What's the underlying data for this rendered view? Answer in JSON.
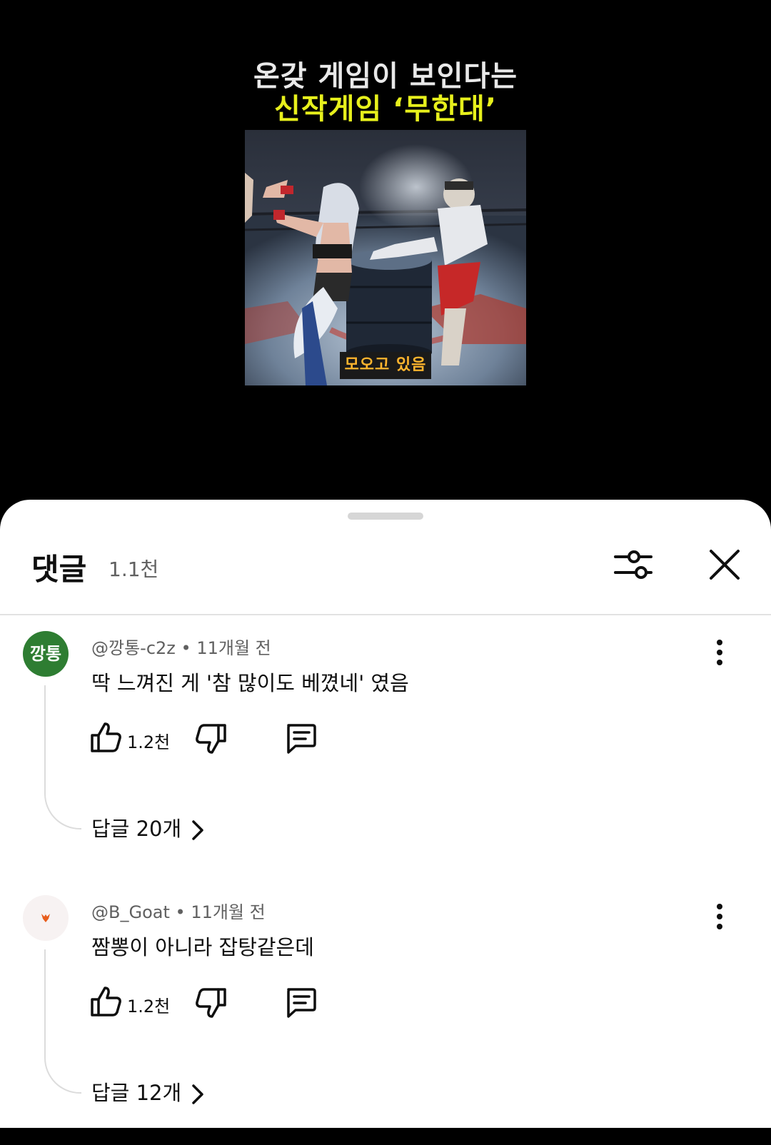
{
  "video": {
    "caption_line1": "온갖 게임이 보인다는",
    "caption_line2": "신작게임 ‘무한대’",
    "subtitle": "모오고 있음",
    "colors": {
      "caption1": "#e9e9e9",
      "caption2": "#e7f01c",
      "subtitle": "#ffb52e"
    }
  },
  "sheet": {
    "title": "댓글",
    "count": "1.1천",
    "filter_icon": "sliders-icon",
    "close_icon": "close-icon"
  },
  "comments": [
    {
      "avatar_text": "깡통",
      "avatar_color": "#2e7d32",
      "author": "@깡통-c2z",
      "time": "11개월 전",
      "text": "딱 느껴진 게 '참 많이도 베꼈네' 였음",
      "likes": "1.2천",
      "replies": "답글 20개"
    },
    {
      "avatar_text": "",
      "avatar_color": "#f7f2f2",
      "author": "@B_Goat",
      "time": "11개월 전",
      "text": "짬뽕이 아니라 잡탕같은데",
      "likes": "1.2천",
      "replies": "답글 12개"
    }
  ]
}
